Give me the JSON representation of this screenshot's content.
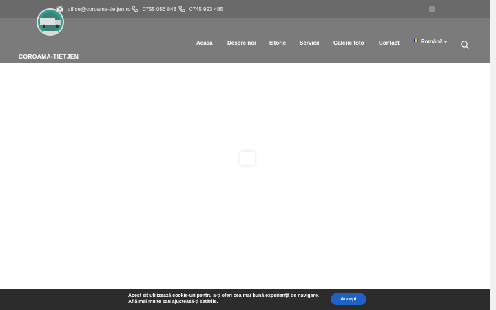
{
  "topbar": {
    "email": "office@coroama-tietjen.ro",
    "phone1": "0755 056 843",
    "phone2": "0745 993 485"
  },
  "logo": {
    "text": "COROAMA-TIETJEN"
  },
  "nav": {
    "items": [
      "Acasă",
      "Despre noi",
      "Istoric",
      "Servicii",
      "Galerie foto",
      "Contact"
    ],
    "language": "Română"
  },
  "cookie": {
    "line1": "Acest sit utilizează cookie-uri pentru a-ți oferi cea mai bună experiență de navigare.",
    "line2_prefix": "Află mai multe sau ajustează-ți ",
    "settings_link": "setările",
    "line2_suffix": ".",
    "accept": "Accept"
  },
  "colors": {
    "topbar": "#6a6a6a",
    "navbar": "#7b7b7b",
    "cookie_bar": "#2c2c2c",
    "accept_button": "#1e62c8"
  },
  "icons": [
    "mail-icon",
    "phone-icon",
    "facebook-icon",
    "search-icon",
    "romania-flag-icon",
    "chevron-down-icon",
    "loading-spinner"
  ]
}
